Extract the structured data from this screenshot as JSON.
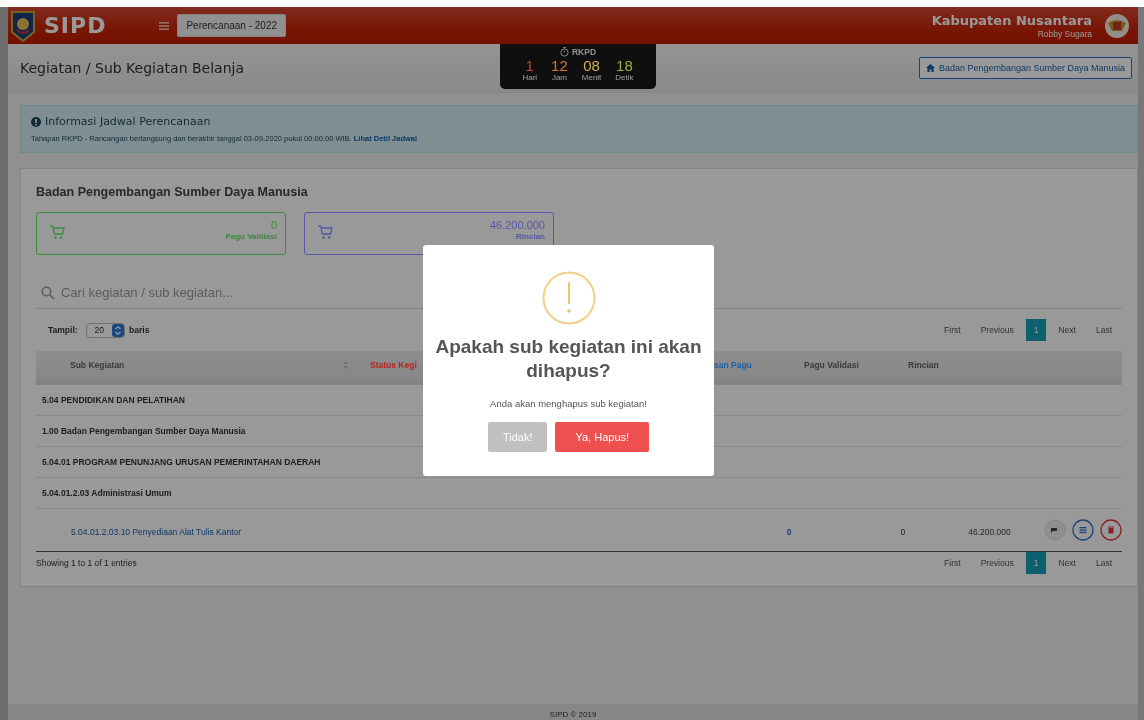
{
  "topbar": {
    "app_name": "SIPD",
    "period": "Perencanaan - 2022",
    "region": "Kabupaten Nusantara",
    "user": "Robby Sugara"
  },
  "header": {
    "title": "Kegiatan / Sub Kegiatan Belanja",
    "unit_button": "Badan Pengembangan Sumber Daya Manusia"
  },
  "timer": {
    "label": "RKPD",
    "units": [
      {
        "value": "1",
        "label": "Hari",
        "color": "#c0453a"
      },
      {
        "value": "12",
        "label": "Jam",
        "color": "#d4782a"
      },
      {
        "value": "08",
        "label": "Menit",
        "color": "#d0b050"
      },
      {
        "value": "18",
        "label": "Detik",
        "color": "#98b040"
      }
    ]
  },
  "info": {
    "title": "Informasi Jadwal Perencanaan",
    "text": "Tahapan RKPD - Rancangan berlangsung dan berakhir tanggal 03-09-2020 pukul 00:00:00 WIB.",
    "link": "Lihat Detil Jadwal"
  },
  "panel": {
    "title": "Badan Pengembangan Sumber Daya Manusia",
    "cards": [
      {
        "value": "0",
        "label": "Pagu Validasi",
        "color": "#3d8b3d"
      },
      {
        "value": "46.200.000",
        "label": "Rincian",
        "color": "#5656a8"
      }
    ],
    "search": {
      "placeholder": "Cari kegiatan / sub kegiatan..."
    },
    "page_size": {
      "label": "Tampil:",
      "value": "20",
      "suffix": "baris"
    },
    "pagination_top": [
      {
        "label": "First",
        "selected": false
      },
      {
        "label": "Previous",
        "selected": false
      },
      {
        "label": "1",
        "selected": true
      },
      {
        "label": "Next",
        "selected": false
      },
      {
        "label": "Last",
        "selected": false
      }
    ],
    "columns": [
      {
        "label": "Sub Kegiatan",
        "color": "#333333"
      },
      {
        "label": "Status Kegi",
        "color": "#c02020"
      },
      {
        "label": "san Pagu",
        "color": "#1a60b0"
      },
      {
        "label": "Pagu Validasi",
        "color": "#333333"
      },
      {
        "label": "Rincian",
        "color": "#333333"
      }
    ],
    "rows": [
      {
        "kind": "group",
        "text": "5.04 PENDIDIKAN DAN PELATIHAN"
      },
      {
        "kind": "group",
        "text": "1.00 Badan Pengembangan Sumber Daya Manusia"
      },
      {
        "kind": "group",
        "text": "5.04.01 PROGRAM PENUNJANG URUSAN PEMERINTAHAN DAERAH"
      },
      {
        "kind": "group",
        "text": "5.04.01.2.03 Administrasi Umum"
      },
      {
        "kind": "item",
        "text": "5.04.01.2.03.10 Penyediaan Alat Tulis Kantor",
        "cells": [
          "0",
          "0",
          "46.200.000"
        ]
      }
    ],
    "entries": "Showing 1 to 1 of 1 entries",
    "pagination_bottom": [
      {
        "label": "First",
        "selected": false
      },
      {
        "label": "Previous",
        "selected": false
      },
      {
        "label": "1",
        "selected": true
      },
      {
        "label": "Next",
        "selected": false
      },
      {
        "label": "Last",
        "selected": false
      }
    ]
  },
  "footer": "SIPD © 2019",
  "modal": {
    "title": "Apakah sub kegiatan ini akan dihapus?",
    "text": "Anda akan menghapus sub kegiatan!",
    "buttons": [
      {
        "label": "Tidak!",
        "kind": "cancel"
      },
      {
        "label": "Ya, Hapus!",
        "kind": "confirm"
      }
    ]
  }
}
